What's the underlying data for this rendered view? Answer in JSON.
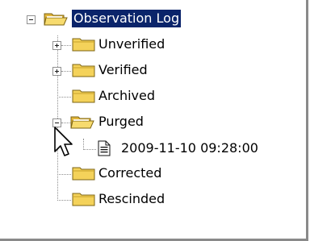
{
  "tree": {
    "root": {
      "label": "Observation Log",
      "expanded": true,
      "selected": true,
      "icon": "folder-open-icon"
    },
    "children": [
      {
        "label": "Unverified",
        "expander": "plus",
        "icon": "folder-closed-icon"
      },
      {
        "label": "Verified",
        "expander": "plus",
        "icon": "folder-closed-icon"
      },
      {
        "label": "Archived",
        "expander": "none",
        "icon": "folder-closed-icon"
      },
      {
        "label": "Purged",
        "expander": "minus",
        "icon": "folder-open-icon",
        "children": [
          {
            "label": "2009-11-10 09:28:00",
            "icon": "document-icon"
          }
        ]
      },
      {
        "label": "Corrected",
        "expander": "none",
        "icon": "folder-closed-icon"
      },
      {
        "label": "Rescinded",
        "expander": "none",
        "icon": "folder-closed-icon"
      }
    ]
  },
  "colors": {
    "selection": "#0a246a",
    "folder": "#f4d25a",
    "connector": "#8e8e8e"
  },
  "cursor": {
    "icon": "arrow-pointer-icon"
  }
}
